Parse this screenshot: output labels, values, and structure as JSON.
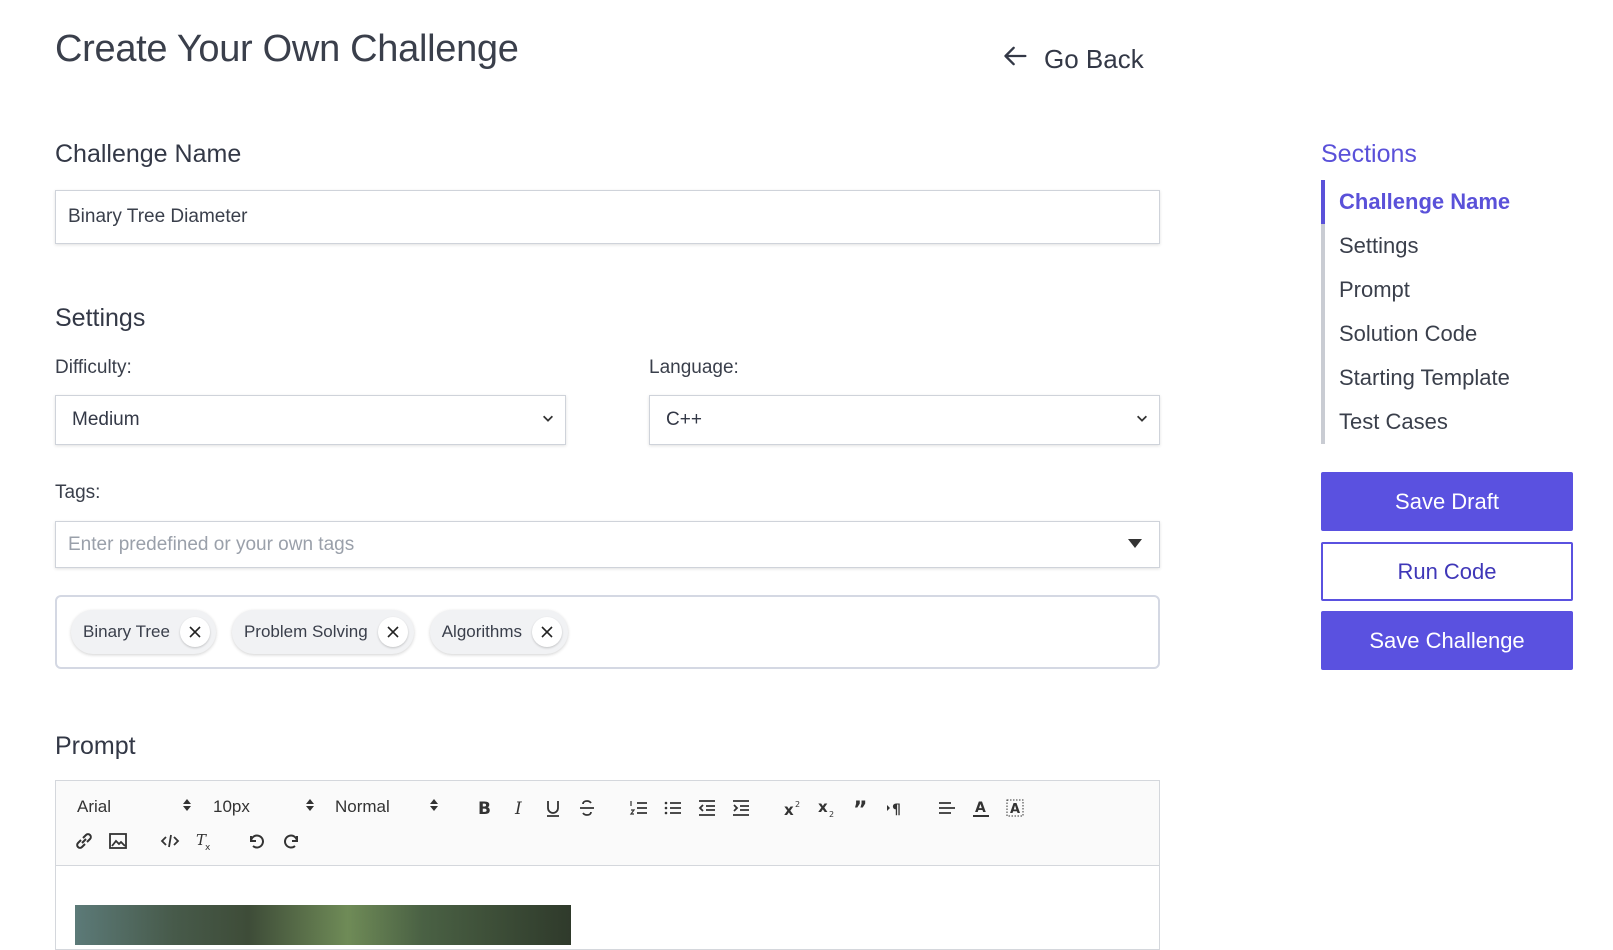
{
  "header": {
    "title": "Create Your Own Challenge",
    "go_back_label": "Go Back"
  },
  "challenge_name": {
    "heading": "Challenge Name",
    "value": "Binary Tree Diameter"
  },
  "settings": {
    "heading": "Settings",
    "difficulty": {
      "label": "Difficulty:",
      "value": "Medium"
    },
    "language": {
      "label": "Language:",
      "value": "C++"
    },
    "tags": {
      "label": "Tags:",
      "placeholder": "Enter predefined or your own tags",
      "selected": [
        "Binary Tree",
        "Problem Solving",
        "Algorithms"
      ]
    }
  },
  "prompt": {
    "heading": "Prompt",
    "toolbar": {
      "font": "Arial",
      "size": "10px",
      "format": "Normal"
    }
  },
  "sidebar": {
    "title": "Sections",
    "items": [
      "Challenge Name",
      "Settings",
      "Prompt",
      "Solution Code",
      "Starting Template",
      "Test Cases"
    ],
    "active_index": 0,
    "save_draft_label": "Save Draft",
    "run_code_label": "Run Code",
    "save_challenge_label": "Save Challenge"
  },
  "colors": {
    "accent": "#5a51e0",
    "accent_text": "#5a51d9",
    "border": "#cfd3da"
  }
}
